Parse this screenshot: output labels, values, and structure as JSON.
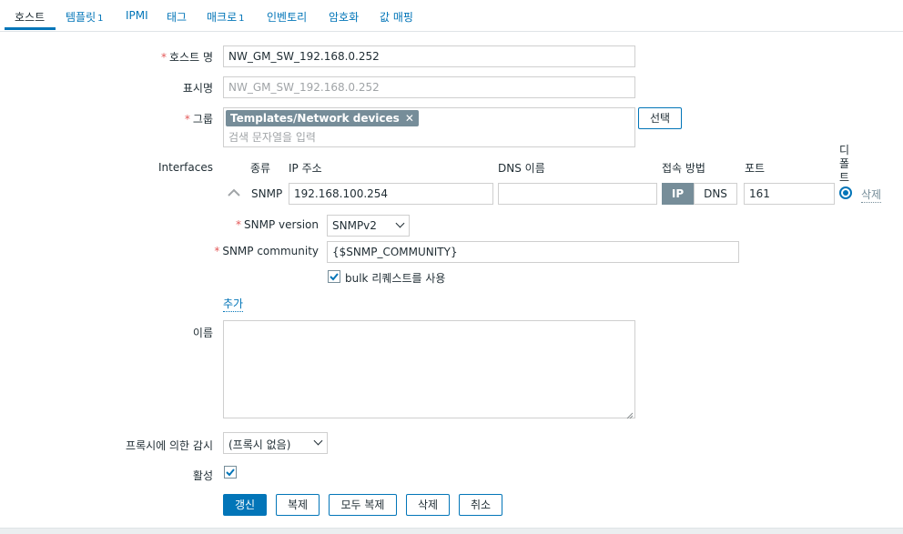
{
  "tabs": [
    {
      "label": "호스트",
      "count": ""
    },
    {
      "label": "템플릿",
      "count": "1"
    },
    {
      "label": "IPMI",
      "count": ""
    },
    {
      "label": "태그",
      "count": ""
    },
    {
      "label": "매크로",
      "count": "1"
    },
    {
      "label": "인벤토리",
      "count": ""
    },
    {
      "label": "암호화",
      "count": ""
    },
    {
      "label": "값 매핑",
      "count": ""
    }
  ],
  "form": {
    "host_name": {
      "label": "호스트 명",
      "value": "NW_GM_SW_192.168.0.252"
    },
    "visible_name": {
      "label": "표시명",
      "placeholder": "NW_GM_SW_192.168.0.252"
    },
    "groups": {
      "label": "그룹",
      "chip": "Templates/Network devices",
      "placeholder": "검색 문자열을 입력",
      "select_button": "선택"
    },
    "interfaces": {
      "label": "Interfaces",
      "headers": {
        "type": "종류",
        "ip": "IP 주소",
        "dns": "DNS 이름",
        "connect": "접속 방법",
        "port": "포트",
        "default": "디폴트"
      },
      "row": {
        "type": "SNMP",
        "ip": "192.168.100.254",
        "dns": "",
        "connect_ip": "IP",
        "connect_dns": "DNS",
        "port": "161",
        "remove": "삭제"
      },
      "snmp_version": {
        "label": "SNMP version",
        "value": "SNMPv2"
      },
      "snmp_community": {
        "label": "SNMP community",
        "value": "{$SNMP_COMMUNITY}"
      },
      "bulk": {
        "label": "bulk 리퀘스트를 사용",
        "checked": true
      },
      "add_link": "추가"
    },
    "description": {
      "label": "이름",
      "value": ""
    },
    "proxy": {
      "label": "프록시에 의한 감시",
      "value": "(프록시 없음)"
    },
    "enabled": {
      "label": "활성",
      "checked": true
    },
    "buttons": {
      "update": "갱신",
      "clone": "복제",
      "full_clone": "모두 복제",
      "delete": "삭제",
      "cancel": "취소"
    }
  },
  "colors": {
    "accent": "#0275b8",
    "required": "#e45959",
    "chip": "#768d99"
  }
}
